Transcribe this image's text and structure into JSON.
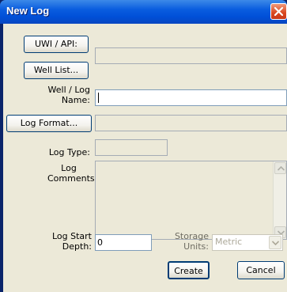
{
  "window": {
    "title": "New Log"
  },
  "buttons": {
    "uwi_api": "UWI / API:",
    "well_list": "Well List...",
    "log_format": "Log Format...",
    "create": "Create",
    "cancel": "Cancel"
  },
  "labels": {
    "well_log_name_1": "Well / Log",
    "well_log_name_2": "Name:",
    "log_type": "Log Type:",
    "log_comments_1": "Log",
    "log_comments_2": "Comments:",
    "log_start_depth_1": "Log Start",
    "log_start_depth_2": "Depth:",
    "storage_units_1": "Storage",
    "storage_units_2": "Units:"
  },
  "fields": {
    "uwi_value": "",
    "well_log_name": "",
    "log_format_value": "",
    "log_type_value": "",
    "log_comments": "",
    "log_start_depth": "0",
    "storage_units": "Metric"
  }
}
